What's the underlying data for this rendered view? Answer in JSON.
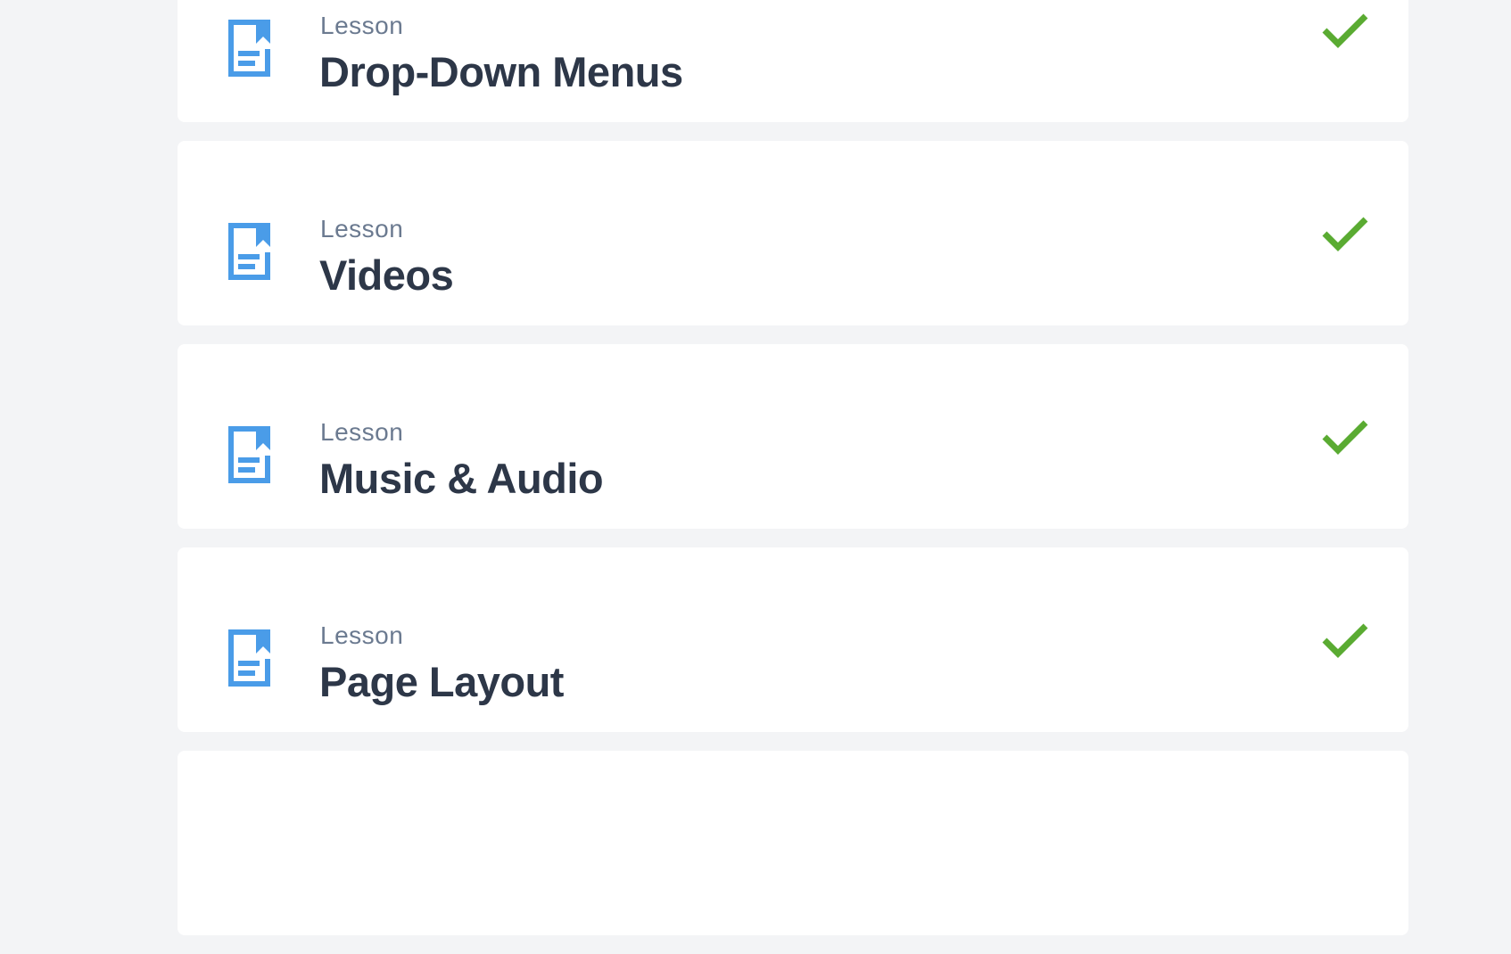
{
  "colors": {
    "background": "#f3f4f6",
    "card_background": "#ffffff",
    "icon_blue": "#4a9ce8",
    "check_green": "#5aab32",
    "type_label": "#6b7a90",
    "title_text": "#2d3748"
  },
  "icons": {
    "lesson": "document-bookmark-icon",
    "status": "checkmark-icon"
  },
  "lessons": [
    {
      "type": "Lesson",
      "title": "Drop-Down Menus",
      "completed": true
    },
    {
      "type": "Lesson",
      "title": "Videos",
      "completed": true
    },
    {
      "type": "Lesson",
      "title": "Music & Audio",
      "completed": true
    },
    {
      "type": "Lesson",
      "title": "Page Layout",
      "completed": true
    }
  ]
}
